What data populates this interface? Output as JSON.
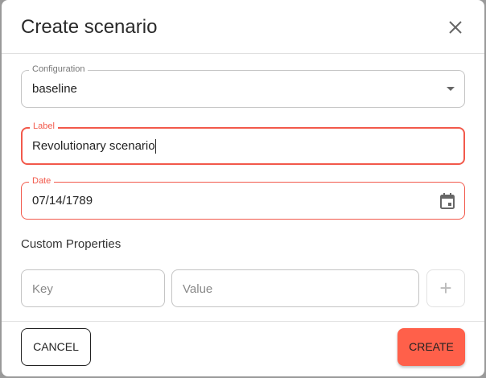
{
  "dialog": {
    "title": "Create scenario",
    "configuration": {
      "label": "Configuration",
      "value": "baseline"
    },
    "label_field": {
      "label": "Label",
      "value": "Revolutionary scenario"
    },
    "date_field": {
      "label": "Date",
      "value": "07/14/1789"
    },
    "custom_properties": {
      "heading": "Custom Properties",
      "key_placeholder": "Key",
      "value_placeholder": "Value",
      "add_label": "+"
    },
    "cancel_label": "CANCEL",
    "create_label": "CREATE",
    "accent_color": "#ff604a",
    "error_color": "#f2594b"
  }
}
